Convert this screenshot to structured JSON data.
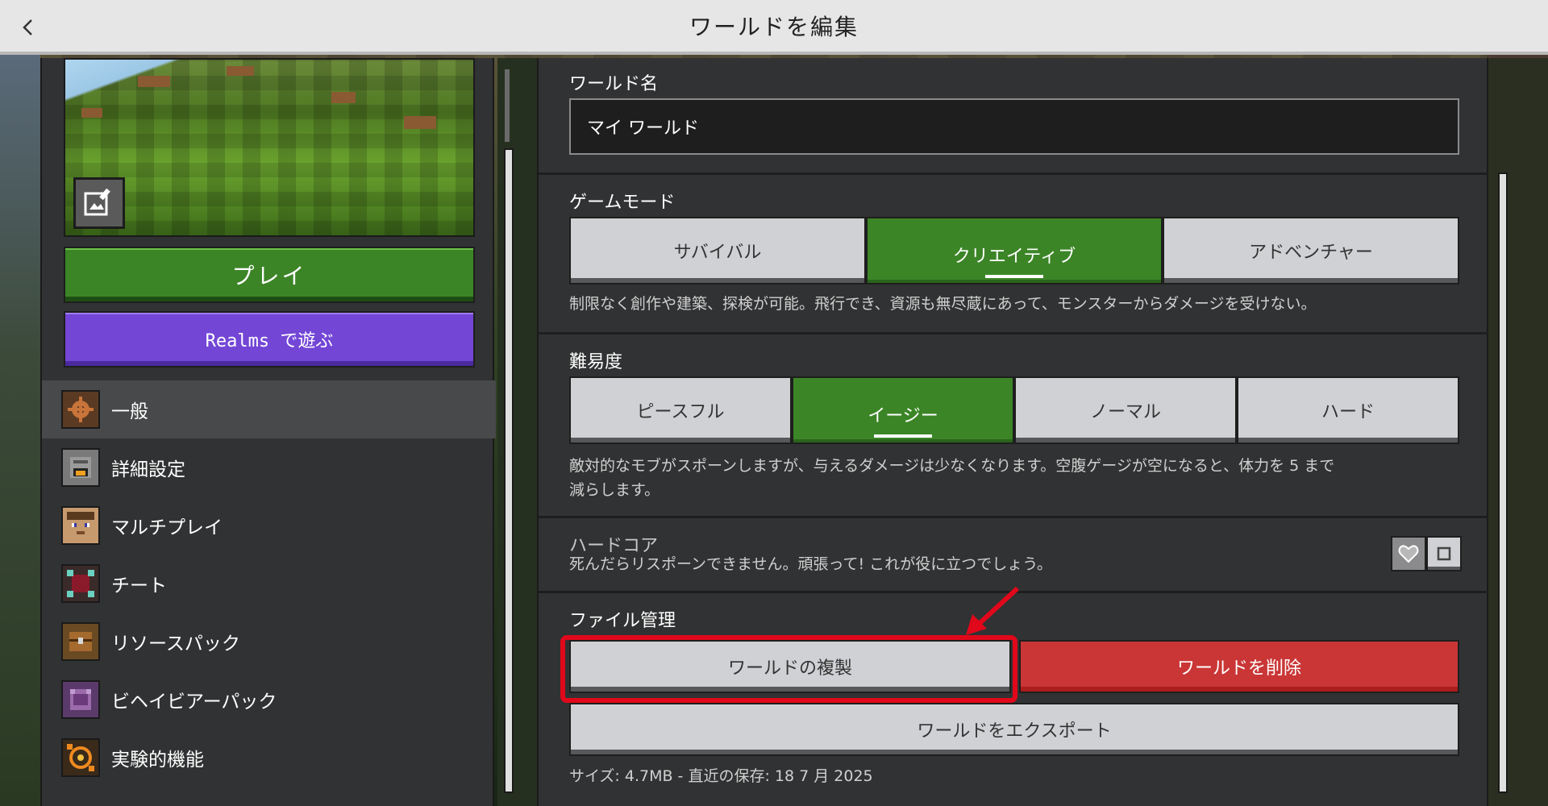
{
  "header": {
    "title": "ワールドを編集",
    "back_icon": "chevron-left-icon"
  },
  "left": {
    "play_label": "プレイ",
    "realms_label": "Realms で遊ぶ",
    "nav": [
      {
        "label": "一般",
        "icon": "gear-block-icon",
        "active": true
      },
      {
        "label": "詳細設定",
        "icon": "furnace-icon",
        "active": false
      },
      {
        "label": "マルチプレイ",
        "icon": "steve-face-icon",
        "active": false
      },
      {
        "label": "チート",
        "icon": "command-block-icon",
        "active": false
      },
      {
        "label": "リソースパック",
        "icon": "chest-icon",
        "active": false
      },
      {
        "label": "ビヘイビアーパック",
        "icon": "behavior-pack-icon",
        "active": false
      },
      {
        "label": "実験的機能",
        "icon": "experiment-icon",
        "active": false
      }
    ]
  },
  "world_name": {
    "title": "ワールド名",
    "value": "マイ ワールド"
  },
  "game_mode": {
    "title": "ゲームモード",
    "options": [
      "サバイバル",
      "クリエイティブ",
      "アドベンチャー"
    ],
    "selected": "クリエイティブ",
    "description": "制限なく創作や建築、探検が可能。飛行でき、資源も無尽蔵にあって、モンスターからダメージを受けない。"
  },
  "difficulty": {
    "title": "難易度",
    "options": [
      "ピースフル",
      "イージー",
      "ノーマル",
      "ハード"
    ],
    "selected": "イージー",
    "description_line1": "敵対的なモブがスポーンしますが、与えるダメージは少なくなります。空腹ゲージが空になると、体力を 5 まで",
    "description_line2": "減らします。"
  },
  "hardcore": {
    "title": "ハードコア",
    "description": "死んだらリスポーンできません。頑張って! これが役に立つでしょう。",
    "enabled": false
  },
  "file_management": {
    "title": "ファイル管理",
    "copy_label": "ワールドの複製",
    "delete_label": "ワールドを削除",
    "export_label": "ワールドをエクスポート",
    "info": "サイズ: 4.7MB - 直近の保存: 18 7 月 2025"
  },
  "colors": {
    "green": "#3c8527",
    "purple": "#7346d6",
    "red": "#ca3636",
    "highlight": "#e0081a"
  }
}
